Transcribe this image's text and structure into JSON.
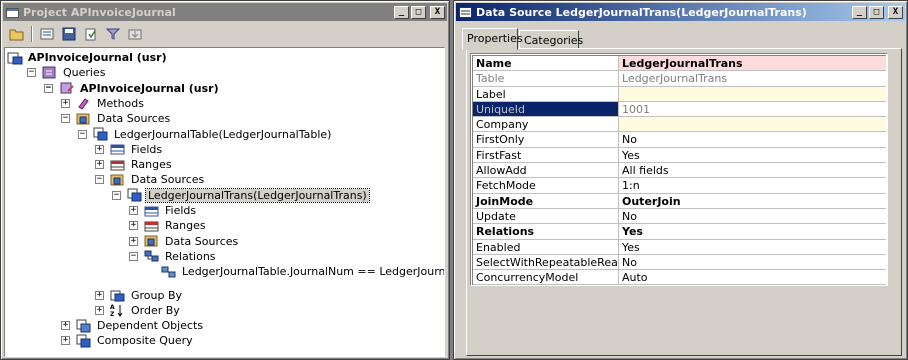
{
  "colors": {
    "active_title": "#0a246a",
    "inactive_title": "#808080",
    "chrome": "#d4d0c8",
    "name_row": "#ffdcdc",
    "required_row": "#fffbe1",
    "selected_key": "#0a246a"
  },
  "project_window": {
    "title": "Project APInvoiceJournal",
    "controls": {
      "minimize": "_",
      "maximize": "□",
      "close": "X"
    },
    "toolbar": [
      "open-icon",
      "properties-icon",
      "save-icon",
      "compile-icon",
      "filter-icon",
      "import-icon"
    ],
    "tree": [
      {
        "label": "APInvoiceJournal (usr)",
        "icon": "query-root-icon",
        "expander": "",
        "bold": true
      },
      {
        "label": "Queries",
        "icon": "queries-folder-icon",
        "expander": "−"
      },
      {
        "label": "APInvoiceJournal (usr)",
        "icon": "query-icon",
        "expander": "−",
        "bold": true
      },
      {
        "label": "Methods",
        "icon": "methods-icon",
        "expander": "+"
      },
      {
        "label": "Data Sources",
        "icon": "datasources-icon",
        "expander": "−"
      },
      {
        "label": "LedgerJournalTable(LedgerJournalTable)",
        "icon": "datasource-icon",
        "expander": "−"
      },
      {
        "label": "Fields",
        "icon": "fields-icon",
        "expander": "+"
      },
      {
        "label": "Ranges",
        "icon": "ranges-icon",
        "expander": "+"
      },
      {
        "label": "Data Sources",
        "icon": "datasources-icon",
        "expander": "−"
      },
      {
        "label": "LedgerJournalTrans(LedgerJournalTrans)",
        "icon": "datasource-icon",
        "expander": "−",
        "selected": true
      },
      {
        "label": "Fields",
        "icon": "fields-icon",
        "expander": "+"
      },
      {
        "label": "Ranges",
        "icon": "ranges-icon",
        "expander": "+"
      },
      {
        "label": "Data Sources",
        "icon": "datasources-icon",
        "expander": "+"
      },
      {
        "label": "Relations",
        "icon": "relations-icon",
        "expander": "−"
      },
      {
        "label": "LedgerJournalTable.JournalNum == LedgerJournalTrans.Journa",
        "icon": "relation-icon",
        "expander": ""
      },
      {
        "label": "Group By",
        "icon": "groupby-icon",
        "expander": "+"
      },
      {
        "label": "Order By",
        "icon": "orderby-icon",
        "expander": "+"
      },
      {
        "label": "Dependent Objects",
        "icon": "dependent-objects-icon",
        "expander": "+"
      },
      {
        "label": "Composite Query",
        "icon": "composite-query-icon",
        "expander": "+"
      }
    ]
  },
  "properties_window": {
    "title": "Data Source LedgerJournalTrans(LedgerJournalTrans)",
    "controls": {
      "minimize": "_",
      "maximize": "□",
      "close": "X"
    },
    "tabs": [
      "Properties",
      "Categories"
    ],
    "rows": [
      {
        "key": "Name",
        "value": "LedgerJournalTrans",
        "style": "b name"
      },
      {
        "key": "Table",
        "value": "LedgerJournalTrans",
        "style": "dis"
      },
      {
        "key": "Label",
        "value": "",
        "style": "note"
      },
      {
        "key": "UniqueId",
        "value": "1001",
        "style": "dis hl"
      },
      {
        "key": "Company",
        "value": "",
        "style": "note"
      },
      {
        "key": "FirstOnly",
        "value": "No",
        "style": ""
      },
      {
        "key": "FirstFast",
        "value": "Yes",
        "style": ""
      },
      {
        "key": "AllowAdd",
        "value": "All fields",
        "style": ""
      },
      {
        "key": "FetchMode",
        "value": "1:n",
        "style": ""
      },
      {
        "key": "JoinMode",
        "value": "OuterJoin",
        "style": "b"
      },
      {
        "key": "Update",
        "value": "No",
        "style": ""
      },
      {
        "key": "Relations",
        "value": "Yes",
        "style": "b"
      },
      {
        "key": "Enabled",
        "value": "Yes",
        "style": ""
      },
      {
        "key": "SelectWithRepeatableRead",
        "value": "No",
        "style": ""
      },
      {
        "key": "ConcurrencyModel",
        "value": "Auto",
        "style": ""
      }
    ]
  }
}
